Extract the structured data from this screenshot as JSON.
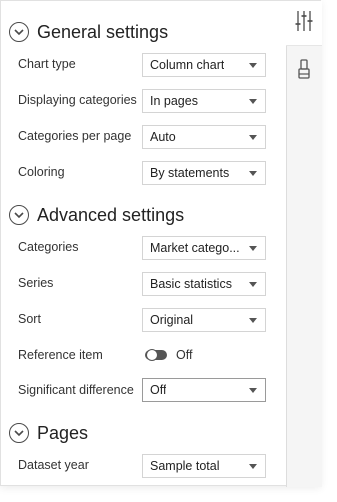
{
  "sections": {
    "general": {
      "title": "General settings",
      "rows": [
        {
          "label": "Chart type",
          "value": "Column chart"
        },
        {
          "label": "Displaying categories",
          "value": "In pages"
        },
        {
          "label": "Categories per page",
          "value": "Auto"
        },
        {
          "label": "Coloring",
          "value": "By statements"
        }
      ]
    },
    "advanced": {
      "title": "Advanced settings",
      "rows": [
        {
          "label": "Categories",
          "value": "Market catego..."
        },
        {
          "label": "Series",
          "value": "Basic statistics"
        },
        {
          "label": "Sort",
          "value": "Original"
        }
      ],
      "reference_item": {
        "label": "Reference item",
        "toggle_text": "Off",
        "on": false
      },
      "significant_difference": {
        "label": "Significant difference",
        "value": "Off"
      }
    },
    "pages": {
      "title": "Pages",
      "rows": [
        {
          "label": "Dataset year",
          "value": "Sample total"
        }
      ]
    }
  },
  "rail": {
    "tabs": [
      {
        "icon": "sliders-icon",
        "active": true
      },
      {
        "icon": "paint-brush-icon",
        "active": false
      }
    ]
  }
}
